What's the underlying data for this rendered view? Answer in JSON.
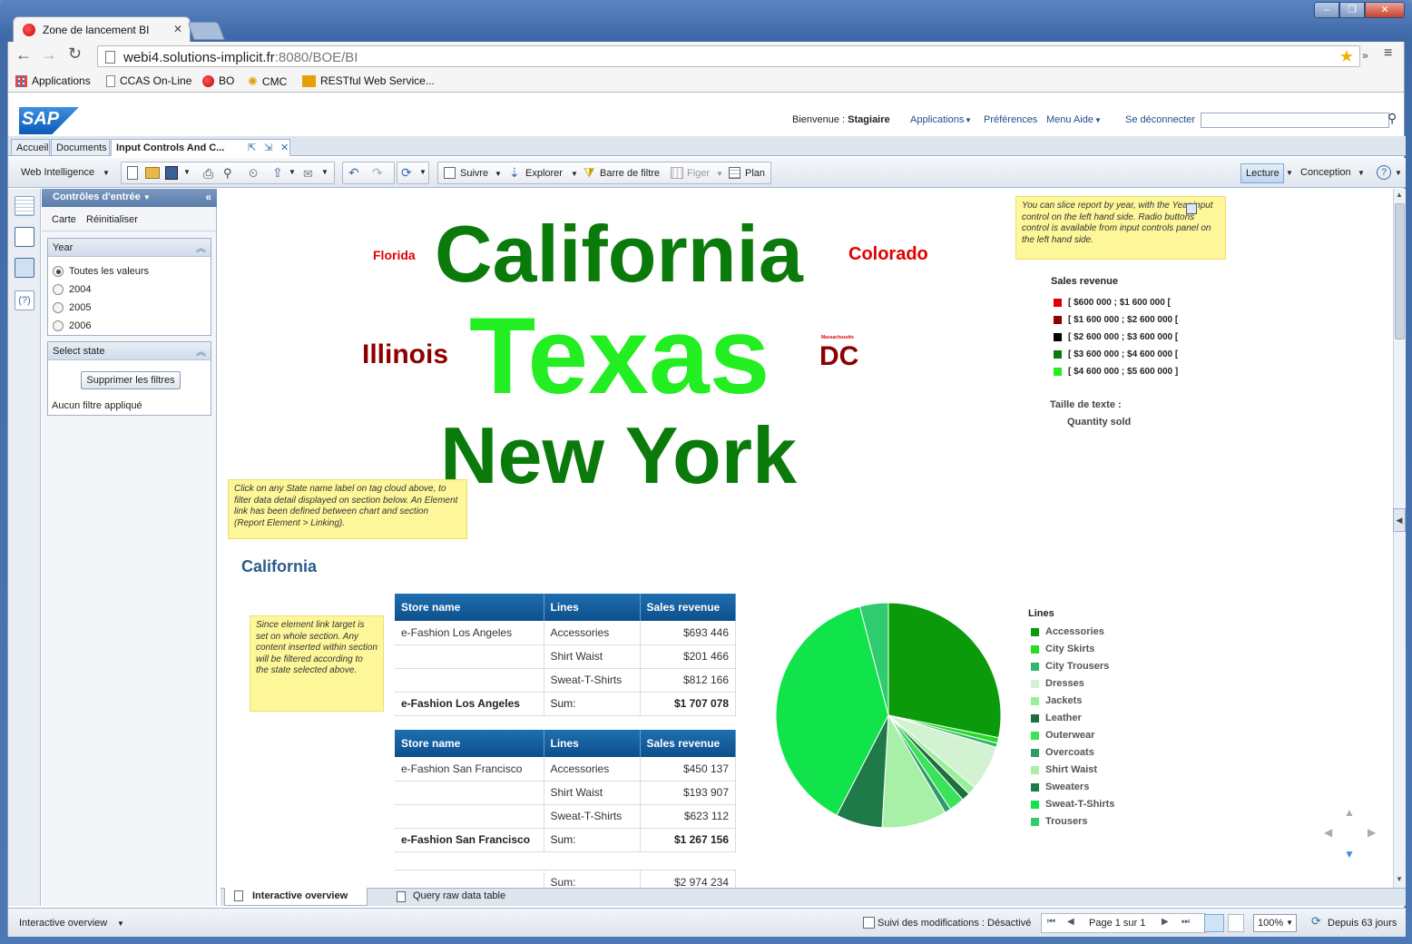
{
  "browser": {
    "tab_title": "Zone de lancement BI",
    "url_host": "webi4.solutions-implicit.fr",
    "url_rest": ":8080/BOE/BI",
    "bookmarks": [
      "Applications",
      "CCAS On-Line",
      "BO",
      "CMC",
      "RESTful Web Service..."
    ]
  },
  "header": {
    "logo": "SAP",
    "welcome": "Bienvenue :",
    "user": "Stagiaire",
    "links": [
      "Applications",
      "Préférences",
      "Menu Aide",
      "Se déconnecter"
    ]
  },
  "doc_tabs": [
    "Accueil",
    "Documents",
    "Input Controls And C..."
  ],
  "toolbar": {
    "mode": "Web Intelligence",
    "buttons": [
      "Suivre",
      "Explorer",
      "Barre de filtre",
      "Figer",
      "Plan"
    ],
    "right": [
      "Lecture",
      "Conception"
    ]
  },
  "panel": {
    "title": "Contrôles d'entrée",
    "links": [
      "Carte",
      "Réinitialiser"
    ],
    "year_box": {
      "title": "Year",
      "options": [
        "Toutes les valeurs",
        "2004",
        "2005",
        "2006"
      ],
      "selected": "Toutes les valeurs"
    },
    "state_box": {
      "title": "Select state",
      "button": "Supprimer les filtres",
      "status": "Aucun filtre appliqué"
    }
  },
  "tag_cloud": {
    "florida": "Florida",
    "california": "California",
    "colorado": "Colorado",
    "illinois": "Illinois",
    "texas": "Texas",
    "massachusetts": "Massachusetts",
    "dc": "DC",
    "newyork": "New York"
  },
  "notes": {
    "slice": "You can slice report by year, with the Year input control on the left hand side. Radio buttons control is available from input controls panel on the left hand side.",
    "click": "Click on any State name label on tag cloud above, to filter data detail displayed on section below. An Element link has been defined between chart and section (Report Element > Linking).",
    "section": "Since element link target is set on whole section. Any content inserted within section will be filtered according to the state selected above."
  },
  "sales_legend": {
    "title": "Sales revenue",
    "items": [
      {
        "label": "[ $600 000 ; $1 600 000 [",
        "color": "#e00000"
      },
      {
        "label": "[ $1 600 000 ; $2 600 000 [",
        "color": "#8b0000"
      },
      {
        "label": "[ $2 600 000 ; $3 600 000 [",
        "color": "#000000"
      },
      {
        "label": "[ $3 600 000 ; $4 600 000 [",
        "color": "#0a7a0a"
      },
      {
        "label": "[ $4 600 000 ; $5 600 000 ]",
        "color": "#22ee22"
      }
    ],
    "size_title": "Taille de texte :",
    "size_measure": "Quantity sold"
  },
  "section_title": "California",
  "tables": [
    {
      "headers": [
        "Store name",
        "Lines",
        "Sales revenue"
      ],
      "rows": [
        [
          "e-Fashion Los Angeles",
          "Accessories",
          "$693 446"
        ],
        [
          "",
          "Shirt Waist",
          "$201 466"
        ],
        [
          "",
          "Sweat-T-Shirts",
          "$812 166"
        ]
      ],
      "sum": [
        "e-Fashion Los Angeles",
        "Sum:",
        "$1 707 078"
      ]
    },
    {
      "headers": [
        "Store name",
        "Lines",
        "Sales revenue"
      ],
      "rows": [
        [
          "e-Fashion San Francisco",
          "Accessories",
          "$450 137"
        ],
        [
          "",
          "Shirt Waist",
          "$193 907"
        ],
        [
          "",
          "Sweat-T-Shirts",
          "$623 112"
        ]
      ],
      "sum": [
        "e-Fashion San Francisco",
        "Sum:",
        "$1 267 156"
      ]
    }
  ],
  "grand_total": {
    "label": "Sum:",
    "value": "$2 974 234"
  },
  "chart_data": {
    "type": "pie",
    "title": "",
    "legend_title": "Lines",
    "legend_position": "right",
    "slices": [
      {
        "name": "Accessories",
        "value": 28.2,
        "color": "#0a9a0a"
      },
      {
        "name": "City Skirts",
        "value": 0.8,
        "color": "#22dd22"
      },
      {
        "name": "City Trousers",
        "value": 0.6,
        "color": "#2fb86a"
      },
      {
        "name": "Dresses",
        "value": 6.5,
        "color": "#d2f2d2"
      },
      {
        "name": "Jackets",
        "value": 1.2,
        "color": "#9af09a"
      },
      {
        "name": "Leather",
        "value": 1.2,
        "color": "#1f6f3f"
      },
      {
        "name": "Outerwear",
        "value": 2.2,
        "color": "#3be35b"
      },
      {
        "name": "Overcoats",
        "value": 0.9,
        "color": "#2f9a6a"
      },
      {
        "name": "Shirt Waist",
        "value": 9.3,
        "color": "#a8f0a8"
      },
      {
        "name": "Sweaters",
        "value": 6.7,
        "color": "#1f7a4a"
      },
      {
        "name": "Sweat-T-Shirts",
        "value": 38.3,
        "color": "#11e34a"
      },
      {
        "name": "Trousers",
        "value": 4.1,
        "color": "#2fcc6f"
      }
    ]
  },
  "report_tabs": [
    "Interactive overview",
    "Query raw data table"
  ],
  "status_bar": {
    "view": "Interactive overview",
    "tracking": "Suivi des modifications : Désactivé",
    "page": "Page 1 sur 1",
    "zoom": "100%",
    "refresh": "Depuis 63 jours"
  }
}
